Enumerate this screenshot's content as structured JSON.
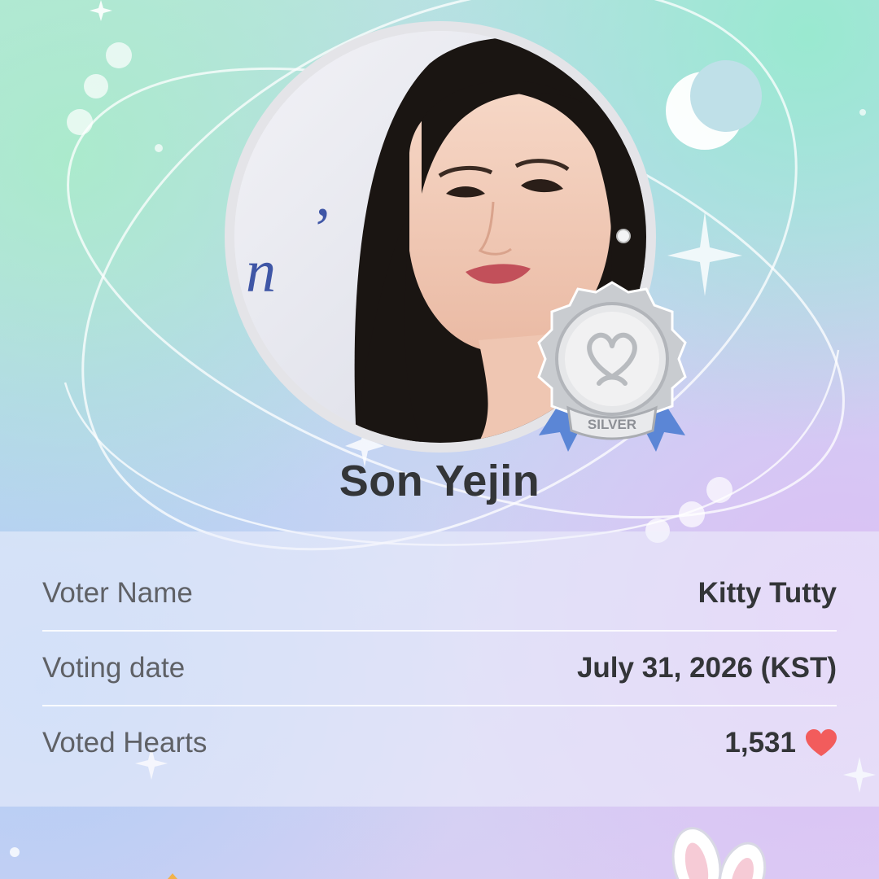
{
  "profile": {
    "name": "Son Yejin",
    "badge_label": "SILVER"
  },
  "info": {
    "rows": [
      {
        "label": "Voter Name",
        "value": "Kitty Tutty"
      },
      {
        "label": "Voting date",
        "value": "July 31, 2026 (KST)"
      },
      {
        "label": "Voted Hearts",
        "value": "1,531"
      }
    ]
  },
  "icons": {
    "heart": "heart-icon",
    "moon": "crescent-moon-icon",
    "sparkle": "sparkle-icon",
    "bunny": "bunny-ears-icon"
  },
  "colors": {
    "heart": "#f25c5c",
    "badge_silver": "#bfc2c6",
    "ribbon": "#5b86d6",
    "name_text": "#333538"
  }
}
